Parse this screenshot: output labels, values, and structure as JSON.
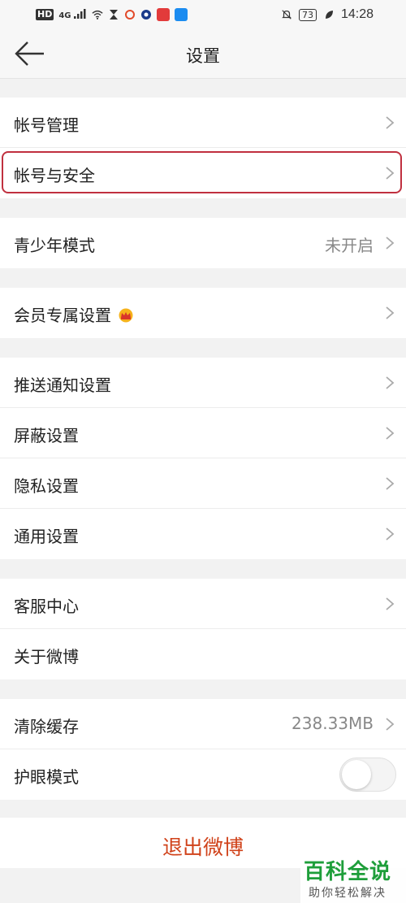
{
  "status_bar": {
    "hd": "HD",
    "signal": "4G",
    "battery": "73",
    "time": "14:28"
  },
  "navbar": {
    "title": "设置"
  },
  "groups": {
    "account": [
      {
        "label": "帐号管理"
      },
      {
        "label": "帐号与安全"
      }
    ],
    "youth": [
      {
        "label": "青少年模式",
        "value": "未开启"
      }
    ],
    "vip": [
      {
        "label": "会员专属设置"
      }
    ],
    "settings": [
      {
        "label": "推送通知设置"
      },
      {
        "label": "屏蔽设置"
      },
      {
        "label": "隐私设置"
      },
      {
        "label": "通用设置"
      }
    ],
    "support": [
      {
        "label": "客服中心"
      },
      {
        "label": "关于微博"
      }
    ],
    "storage": [
      {
        "label": "清除缓存",
        "value": "238.33MB"
      },
      {
        "label": "护眼模式",
        "toggle_on": false
      }
    ]
  },
  "logout": {
    "label": "退出微博",
    "color": "#d0421a"
  },
  "watermark": {
    "title": "百科全说",
    "subtitle": "助你轻松解决"
  },
  "colors": {
    "highlight": "#c0303f",
    "watermark_green": "#1e9e3a"
  }
}
